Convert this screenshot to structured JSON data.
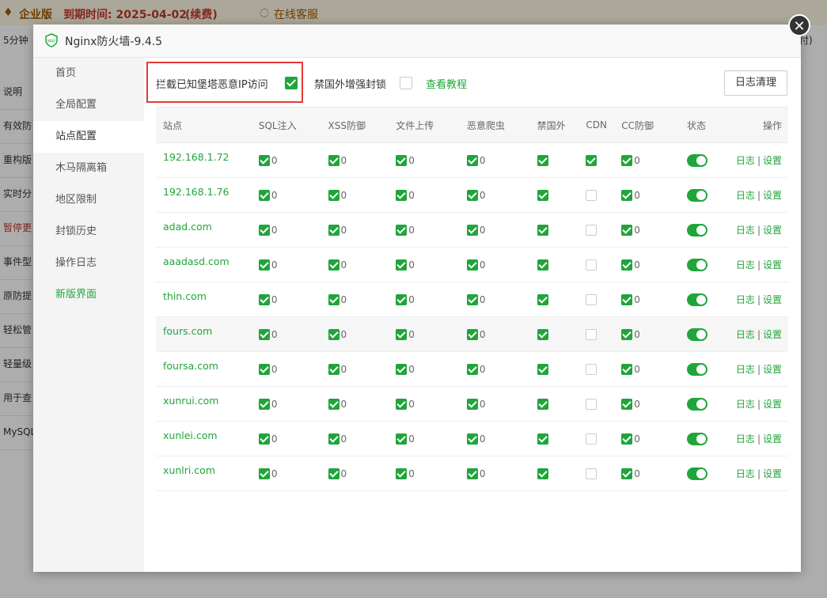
{
  "background": {
    "edition": "企业版",
    "expire": "到期时间: 2025-04-02",
    "renew": "(续费)",
    "support": "在线客服",
    "sub_left": "5分钟",
    "sub_right": "付)",
    "list": [
      "说明",
      "有效防",
      "重构版",
      "实时分",
      "暂停更",
      "事件型",
      "原防提",
      "轻松管",
      "轻量级",
      "用于查",
      "MySQL"
    ]
  },
  "dialog": {
    "title": "Nginx防火墙-9.4.5",
    "close_icon": "close-icon"
  },
  "sidebar": {
    "items": [
      {
        "label": "首页"
      },
      {
        "label": "全局配置"
      },
      {
        "label": "站点配置"
      },
      {
        "label": "木马隔离箱"
      },
      {
        "label": "地区限制"
      },
      {
        "label": "封锁历史"
      },
      {
        "label": "操作日志"
      },
      {
        "label": "新版界面"
      }
    ],
    "active_index": 2
  },
  "options": {
    "block_malicious_ip_label": "拦截已知堡塔恶意IP访问",
    "block_malicious_ip_checked": true,
    "ban_foreign_label": "禁国外增强封锁",
    "ban_foreign_checked": false,
    "tutorial_link": "查看教程",
    "clear_log_button": "日志清理"
  },
  "table": {
    "headers": [
      "站点",
      "SQL注入",
      "XSS防御",
      "文件上传",
      "恶意爬虫",
      "禁国外",
      "CDN",
      "CC防御",
      "状态",
      "操作"
    ],
    "op_log": "日志",
    "op_sep": "|",
    "op_settings": "设置",
    "rows": [
      {
        "site": "192.168.1.72",
        "sql": "0",
        "xss": "0",
        "upload": "0",
        "spider": "0",
        "cdn": true,
        "cc": "0"
      },
      {
        "site": "192.168.1.76",
        "sql": "0",
        "xss": "0",
        "upload": "0",
        "spider": "0",
        "cdn": false,
        "cc": "0"
      },
      {
        "site": "adad.com",
        "sql": "0",
        "xss": "0",
        "upload": "0",
        "spider": "0",
        "cdn": false,
        "cc": "0"
      },
      {
        "site": "aaadasd.com",
        "sql": "0",
        "xss": "0",
        "upload": "0",
        "spider": "0",
        "cdn": false,
        "cc": "0"
      },
      {
        "site": "thin.com",
        "sql": "0",
        "xss": "0",
        "upload": "0",
        "spider": "0",
        "cdn": false,
        "cc": "0"
      },
      {
        "site": "fours.com",
        "sql": "0",
        "xss": "0",
        "upload": "0",
        "spider": "0",
        "cdn": false,
        "cc": "0"
      },
      {
        "site": "foursa.com",
        "sql": "0",
        "xss": "0",
        "upload": "0",
        "spider": "0",
        "cdn": false,
        "cc": "0"
      },
      {
        "site": "xunrui.com",
        "sql": "0",
        "xss": "0",
        "upload": "0",
        "spider": "0",
        "cdn": false,
        "cc": "0"
      },
      {
        "site": "xunlei.com",
        "sql": "0",
        "xss": "0",
        "upload": "0",
        "spider": "0",
        "cdn": false,
        "cc": "0"
      },
      {
        "site": "xunlri.com",
        "sql": "0",
        "xss": "0",
        "upload": "0",
        "spider": "0",
        "cdn": false,
        "cc": "0"
      }
    ],
    "highlighted_row": 5
  },
  "colors": {
    "accent": "#20a53a",
    "highlight_border": "#e53935"
  }
}
